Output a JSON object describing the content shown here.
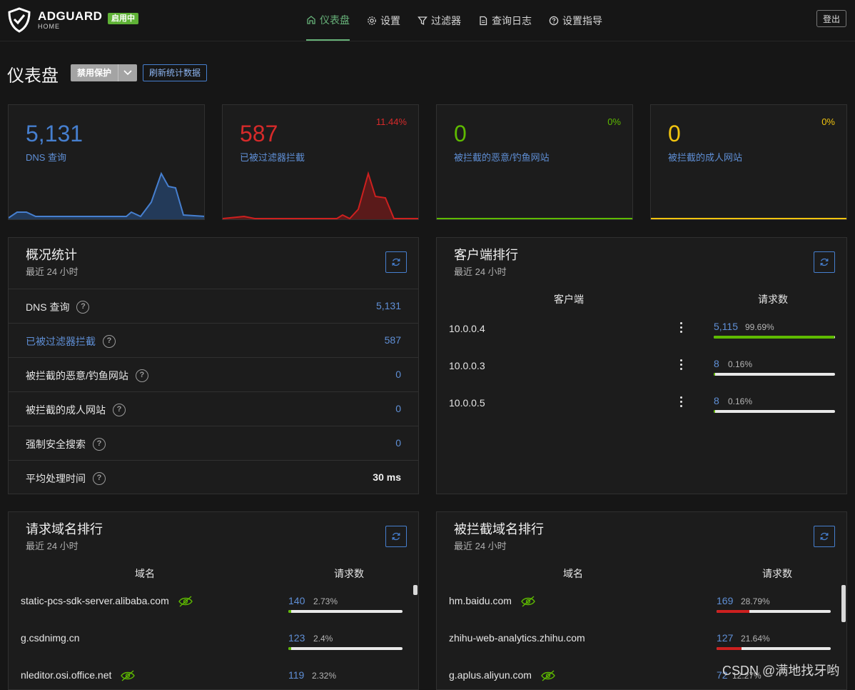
{
  "header": {
    "brand": "ADGUARD",
    "brand_sub": "HOME",
    "status_badge": "启用中",
    "nav": [
      {
        "label": "仪表盘",
        "icon": "home-icon"
      },
      {
        "label": "设置",
        "icon": "gear-icon"
      },
      {
        "label": "过滤器",
        "icon": "filter-icon"
      },
      {
        "label": "查询日志",
        "icon": "document-icon"
      },
      {
        "label": "设置指导",
        "icon": "help-circle-icon"
      }
    ],
    "logout": "登出"
  },
  "page": {
    "title": "仪表盘",
    "disable_label": "禁用保护",
    "refresh_label": "刷新统计数据"
  },
  "cards": [
    {
      "value": "5,131",
      "label": "DNS 查询",
      "percent": "",
      "color": "#467fcf"
    },
    {
      "value": "587",
      "label": "已被过滤器拦截",
      "percent": "11.44%",
      "color": "#cd201f"
    },
    {
      "value": "0",
      "label": "被拦截的恶意/钓鱼网站",
      "percent": "0%",
      "color": "#5eba00"
    },
    {
      "value": "0",
      "label": "被拦截的成人网站",
      "percent": "0%",
      "color": "#f1c40f"
    }
  ],
  "general": {
    "title": "概况统计",
    "subtitle": "最近 24 小时",
    "rows": [
      {
        "label": "DNS 查询",
        "value": "5,131"
      },
      {
        "label": "已被过滤器拦截",
        "value": "587"
      },
      {
        "label": "被拦截的恶意/钓鱼网站",
        "value": "0"
      },
      {
        "label": "被拦截的成人网站",
        "value": "0"
      },
      {
        "label": "强制安全搜索",
        "value": "0"
      },
      {
        "label": "平均处理时间",
        "value": "30 ms"
      }
    ]
  },
  "clients": {
    "title": "客户端排行",
    "subtitle": "最近 24 小时",
    "col_client": "客户端",
    "col_count": "请求数",
    "rows": [
      {
        "name": "10.0.0.4",
        "count": "5,115",
        "percent": "99.69%",
        "fraction": 0.9969
      },
      {
        "name": "10.0.0.3",
        "count": "8",
        "percent": "0.16%",
        "fraction": 0.0016
      },
      {
        "name": "10.0.0.5",
        "count": "8",
        "percent": "0.16%",
        "fraction": 0.0016
      }
    ]
  },
  "queried": {
    "title": "请求域名排行",
    "subtitle": "最近 24 小时",
    "col_domain": "域名",
    "col_count": "请求数",
    "rows": [
      {
        "domain": "static-pcs-sdk-server.alibaba.com",
        "count": "140",
        "percent": "2.73%",
        "fraction": 0.0273
      },
      {
        "domain": "g.csdnimg.cn",
        "count": "123",
        "percent": "2.4%",
        "fraction": 0.024
      },
      {
        "domain": "nleditor.osi.office.net",
        "count": "119",
        "percent": "2.32%",
        "fraction": 0.0232
      }
    ]
  },
  "blocked": {
    "title": "被拦截域名排行",
    "subtitle": "最近 24 小时",
    "col_domain": "域名",
    "col_count": "请求数",
    "rows": [
      {
        "domain": "hm.baidu.com",
        "count": "169",
        "percent": "28.79%",
        "fraction": 0.2879
      },
      {
        "domain": "zhihu-web-analytics.zhihu.com",
        "count": "127",
        "percent": "21.64%",
        "fraction": 0.2164
      },
      {
        "domain": "g.aplus.aliyun.com",
        "count": "72",
        "percent": "12.27%",
        "fraction": 0.1227
      }
    ]
  },
  "watermark": "CSDN @满地找牙哟"
}
